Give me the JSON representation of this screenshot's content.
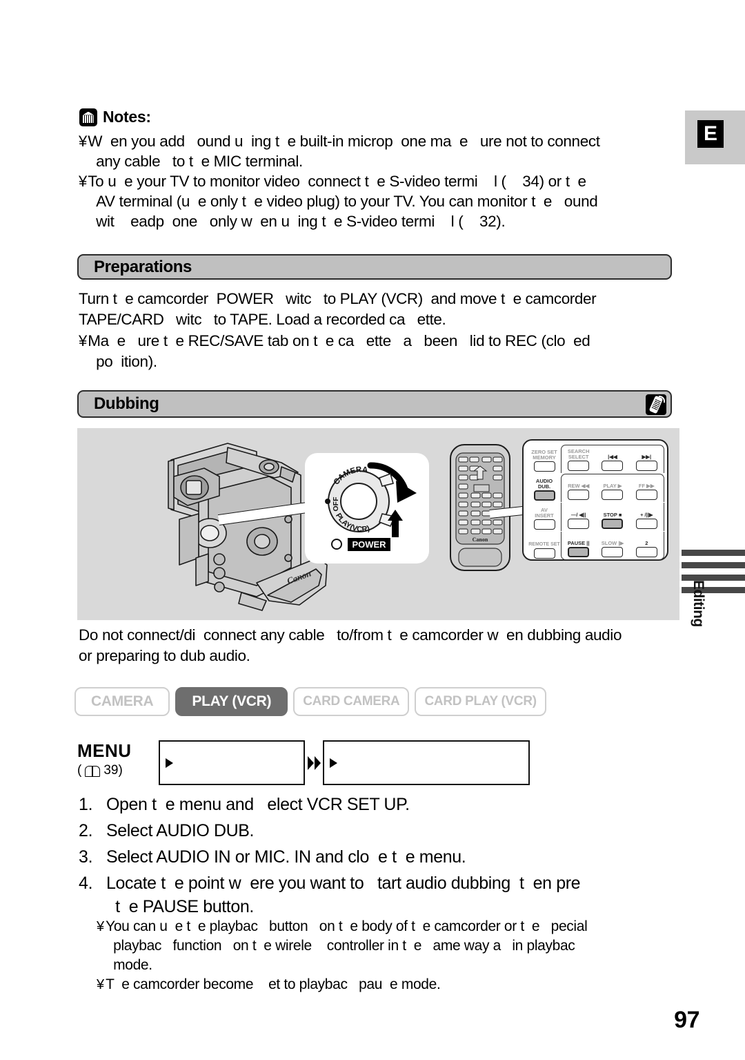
{
  "tab": {
    "letter": "E"
  },
  "notes": {
    "icon": "notes-icon",
    "title": "Notes:",
    "bullet": "¥",
    "items": [
      "W  en you add   ound u  ing t  e built-in microp  one ma  e   ure not to connect\n  any cable   to t  e MIC terminal.",
      "To u  e your TV to monitor video  connect t  e S-video termi    l (    34) or t  e\n  AV terminal (u  e only t  e video plug) to your TV. You can monitor t  e   ound\n  wit    eadp  one   only w  en u  ing t  e S-video termi    l (    32)."
    ]
  },
  "preparations": {
    "heading": "Preparations",
    "paragraph": "Turn t  e camcorder  POWER   witc   to PLAY (VCR)  and move t  e camcorder\nTAPE/CARD   witc   to TAPE. Load a recorded ca   ette.",
    "bullet": "¥",
    "note": "Ma  e   ure t  e REC/SAVE tab on t  e ca   ette   a   been   lid to REC (clo  ed\n  po  ition)."
  },
  "dubbing": {
    "heading": "Dubbing",
    "badge_icon": "wireless-remote-icon",
    "warning": "Do not connect/di  connect any cable   to/from t  e camcorder w  en dubbing audio\nor preparing to dub audio."
  },
  "illustration": {
    "camcorder_label": "Canon",
    "dial": {
      "camera": "CAMERA",
      "off": "OFF",
      "play": "PLAY(VCR)",
      "power": "POWER"
    },
    "remote": {
      "brand": "Canon",
      "buttons": [
        {
          "label": "ZERO SET\nMEMORY",
          "highlight": false,
          "dim": true
        },
        {
          "label": "SEARCH\nSELECT",
          "highlight": false,
          "dim": true
        },
        {
          "label": "|◀◀",
          "highlight": false,
          "dim": false
        },
        {
          "label": "▶▶|",
          "highlight": false,
          "dim": false
        },
        {
          "label": "AUDIO\nDUB.",
          "highlight": true,
          "dim": false
        },
        {
          "label": "REW ◀◀",
          "highlight": false,
          "dim": true
        },
        {
          "label": "PLAY ▶",
          "highlight": false,
          "dim": true
        },
        {
          "label": "FF ▶▶",
          "highlight": false,
          "dim": true
        },
        {
          "label": "AV\nINSERT",
          "highlight": false,
          "dim": true
        },
        {
          "label": "—/ ◀||",
          "highlight": false,
          "dim": false
        },
        {
          "label": "STOP ■",
          "highlight": true,
          "dim": false
        },
        {
          "label": "+ /||▶",
          "highlight": false,
          "dim": false
        },
        {
          "label": "REMOTE SET",
          "highlight": false,
          "dim": true
        },
        {
          "label": "PAUSE ||",
          "highlight": true,
          "dim": false
        },
        {
          "label": "SLOW |▶",
          "highlight": false,
          "dim": true
        },
        {
          "label": "2",
          "highlight": false,
          "dim": false
        }
      ]
    }
  },
  "sidebar": {
    "editing_label": "Editing",
    "stripe_count": 4,
    "stripe_color": "#474747"
  },
  "modes": [
    {
      "label": "CAMERA",
      "active": false
    },
    {
      "label": "PLAY (VCR)",
      "active": true
    },
    {
      "label": "CARD CAMERA",
      "active": false
    },
    {
      "label": "CARD PLAY (VCR)",
      "active": false
    }
  ],
  "menu": {
    "word": "MENU",
    "ref_open": "(",
    "ref_page": "39)",
    "box1": "",
    "box2": ""
  },
  "steps": [
    {
      "num": "1.",
      "text": "Open t  e menu and   elect VCR SET UP."
    },
    {
      "num": "2.",
      "text": "Select AUDIO DUB."
    },
    {
      "num": "3.",
      "text": "Select AUDIO IN or MIC. IN and clo  e t  e menu."
    },
    {
      "num": "4.",
      "text": "Locate t  e point w  ere you want to   tart audio dubbing  t  en pre\n  t  e PAUSE button."
    }
  ],
  "sub_notes": {
    "bullet": "¥",
    "items": [
      "You can u  e t  e playbac   button   on t  e body of t  e camcorder or t  e   pecial\n  playbac   function   on t  e wirele    controller in t  e   ame way a   in playbac\n  mode.",
      "T  e camcorder become    et to playbac   pau  e mode."
    ]
  },
  "page_number": "97"
}
